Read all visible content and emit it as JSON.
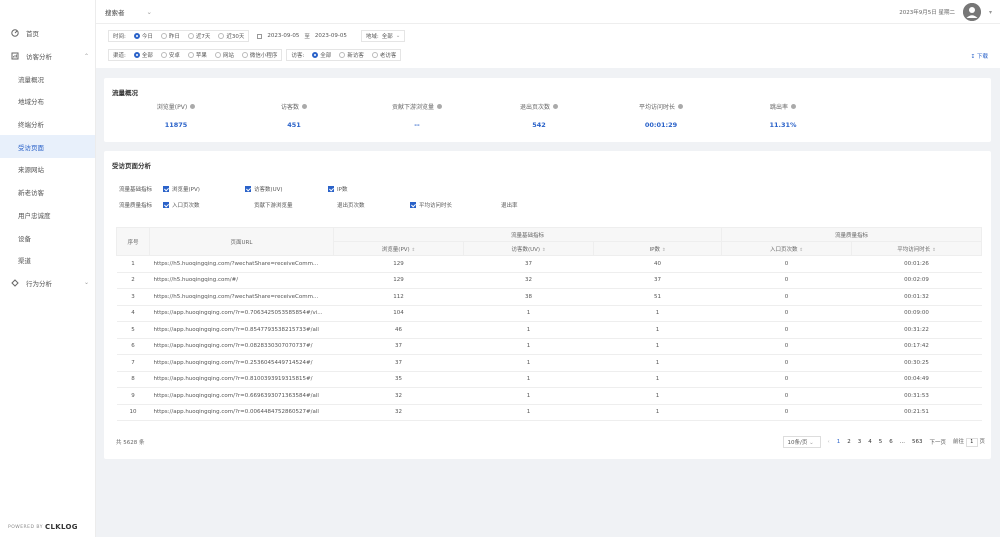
{
  "header": {
    "project": "搜索者",
    "date_text": "2023年9月5日 星期二"
  },
  "sidebar": {
    "items": [
      {
        "label": "首页",
        "icon": "dashboard-icon"
      },
      {
        "label": "访客分析",
        "icon": "chart-icon"
      },
      {
        "label": "流量概况"
      },
      {
        "label": "地域分布"
      },
      {
        "label": "终端分析"
      },
      {
        "label": "受访页面"
      },
      {
        "label": "来源网站"
      },
      {
        "label": "新老访客"
      },
      {
        "label": "用户忠诚度"
      },
      {
        "label": "设备"
      },
      {
        "label": "渠道"
      },
      {
        "label": "行为分析",
        "icon": "behavior-icon"
      }
    ],
    "powered": "POWERED BY",
    "brand": "CLKLOG"
  },
  "filters": {
    "time_label": "时间:",
    "time_options": [
      "今日",
      "昨日",
      "近7天",
      "近30天"
    ],
    "date_from": "2023-09-05",
    "date_to_sep": "至",
    "date_to": "2023-09-05",
    "region_label": "地域:",
    "region_value": "全部",
    "channel_label": "渠道:",
    "channel_options": [
      "全部",
      "安卓",
      "苹果",
      "网站",
      "微信小程序"
    ],
    "visitor_label": "访客:",
    "visitor_options": [
      "全部",
      "新访客",
      "老访客"
    ],
    "download": "下载"
  },
  "overview": {
    "title": "流量概况",
    "metrics": [
      {
        "label": "浏览量(PV)",
        "value": "11875"
      },
      {
        "label": "访客数",
        "value": "451"
      },
      {
        "label": "贡献下游浏览量",
        "value": "--"
      },
      {
        "label": "退出页次数",
        "value": "542"
      },
      {
        "label": "平均访问时长",
        "value": "00:01:29"
      },
      {
        "label": "跳出率",
        "value": "11.31%"
      }
    ]
  },
  "page_analysis": {
    "title": "受访页面分析",
    "row1_label": "流量基础指标",
    "row1_checks": [
      {
        "label": "浏览量(PV)",
        "checked": true
      },
      {
        "label": "访客数(UV)",
        "checked": true
      },
      {
        "label": "IP数",
        "checked": true
      }
    ],
    "row2_label": "流量质量指标",
    "row2_checks": [
      {
        "label": "入口页次数",
        "checked": true
      },
      {
        "label": "贡献下游浏览量",
        "checked": false
      },
      {
        "label": "退出页次数",
        "checked": false
      },
      {
        "label": "平均访问时长",
        "checked": true
      },
      {
        "label": "退出率",
        "checked": false
      }
    ],
    "group_headers": {
      "basic": "流量基础指标",
      "quality": "流量质量指标"
    },
    "columns": [
      "序号",
      "页面URL",
      "浏览量(PV)",
      "访客数(UV)",
      "IP数",
      "入口页次数",
      "平均访问时长"
    ],
    "rows": [
      [
        "1",
        "https://h5.huoqingqing.com/?wechatShare=receiveComm...",
        "129",
        "37",
        "40",
        "0",
        "00:01:26"
      ],
      [
        "2",
        "https://h5.huoqingqing.com/#/",
        "129",
        "32",
        "37",
        "0",
        "00:02:09"
      ],
      [
        "3",
        "https://h5.huoqingqing.com/?wechatShare=receiveComm...",
        "112",
        "38",
        "51",
        "0",
        "00:01:32"
      ],
      [
        "4",
        "https://app.huoqingqing.com/?r=0.7063425053585854#/vi...",
        "104",
        "1",
        "1",
        "0",
        "00:09:00"
      ],
      [
        "5",
        "https://app.huoqingqing.com/?r=0.8547793538215733#/all",
        "46",
        "1",
        "1",
        "0",
        "00:31:22"
      ],
      [
        "6",
        "https://app.huoqingqing.com/?r=0.0828330307070737#/",
        "37",
        "1",
        "1",
        "0",
        "00:17:42"
      ],
      [
        "7",
        "https://app.huoqingqing.com/?r=0.2536045449714524#/",
        "37",
        "1",
        "1",
        "0",
        "00:30:25"
      ],
      [
        "8",
        "https://app.huoqingqing.com/?r=0.8100393919315815#/",
        "35",
        "1",
        "1",
        "0",
        "00:04:49"
      ],
      [
        "9",
        "https://app.huoqingqing.com/?r=0.6696393071363584#/all",
        "32",
        "1",
        "1",
        "0",
        "00:31:53"
      ],
      [
        "10",
        "https://app.huoqingqing.com/?r=0.0064484752860527#/all",
        "32",
        "1",
        "1",
        "0",
        "00:21:51"
      ]
    ],
    "total": "共 5628 条",
    "page_size": "10条/页",
    "pages": [
      "1",
      "2",
      "3",
      "4",
      "5",
      "6",
      "...",
      "563"
    ],
    "next": "下一页",
    "goto_label": "前往",
    "goto_value": "1",
    "goto_suffix": "页"
  }
}
